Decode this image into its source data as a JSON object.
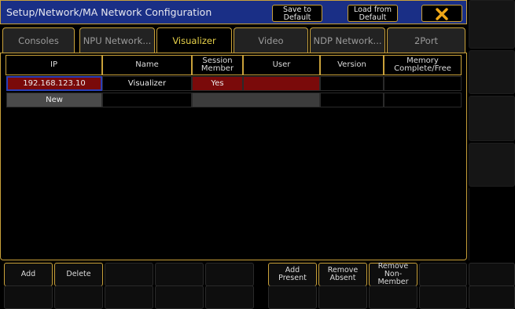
{
  "titlebar": {
    "title": "Setup/Network/MA Network Configuration",
    "save_line1": "Save to",
    "save_line2": "Default",
    "load_line1": "Load from",
    "load_line2": "Default"
  },
  "tabs": [
    "Consoles",
    "NPU Network...",
    "Visualizer",
    "Video",
    "NDP Network...",
    "2Port"
  ],
  "active_tab": "Visualizer",
  "table": {
    "headers": {
      "ip": "IP",
      "name": "Name",
      "session_line1": "Session",
      "session_line2": "Member",
      "user": "User",
      "version": "Version",
      "memory_line1": "Memory",
      "memory_line2": "Complete/Free"
    },
    "rows": [
      {
        "ip": "192.168.123.10",
        "name": "Visualizer",
        "session": "Yes",
        "user": "",
        "version": "",
        "memory": ""
      },
      {
        "ip": "New",
        "name": "",
        "session": "",
        "user": "",
        "version": "",
        "memory": ""
      }
    ]
  },
  "bottom": {
    "add": "Add",
    "delete": "Delete",
    "add_present_1": "Add",
    "add_present_2": "Present",
    "remove_absent_1": "Remove",
    "remove_absent_2": "Absent",
    "remove_nonmember_1": "Remove",
    "remove_nonmember_2": "Non-Member"
  },
  "colors": {
    "accent": "#c9a13a",
    "titlebar": "#1a2f86",
    "selected_cell": "#7a0a0a",
    "close_icon": "#f0a818",
    "active_tab_text": "#e8d24a"
  }
}
